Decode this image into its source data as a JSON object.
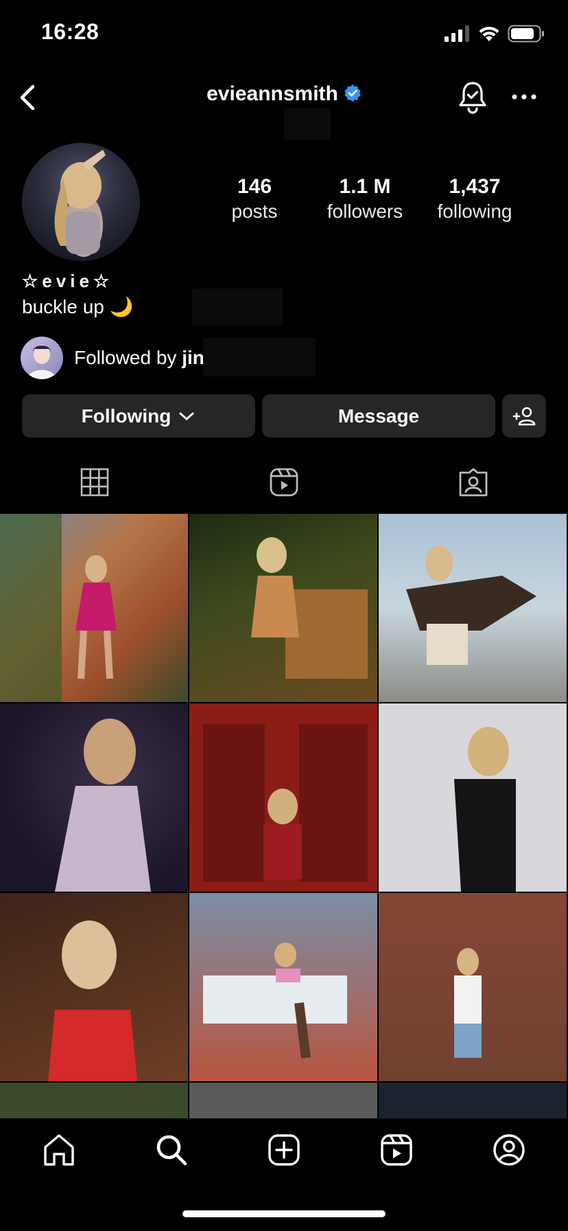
{
  "status_bar": {
    "time": "16:28"
  },
  "header": {
    "username": "evieannsmith"
  },
  "profile": {
    "display_name": "☆evie☆",
    "bio": "buckle up 🌙",
    "stats": [
      {
        "value": "146",
        "label": "posts"
      },
      {
        "value": "1.1 M",
        "label": "followers"
      },
      {
        "value": "1,437",
        "label": "following"
      }
    ],
    "followed_by_prefix": "Followed by ",
    "followed_by_name": "jin"
  },
  "actions": {
    "following_label": "Following",
    "message_label": "Message"
  },
  "tabs": [
    {
      "icon": "grid-icon"
    },
    {
      "icon": "reels-icon"
    },
    {
      "icon": "tagged-icon"
    }
  ],
  "nav": [
    {
      "icon": "home-icon"
    },
    {
      "icon": "search-icon"
    },
    {
      "icon": "create-icon"
    },
    {
      "icon": "reels-icon"
    },
    {
      "icon": "profile-icon"
    }
  ],
  "colors": {
    "background": "#000000",
    "button": "#262626",
    "verified": "#3897f0",
    "text": "#ffffff"
  }
}
